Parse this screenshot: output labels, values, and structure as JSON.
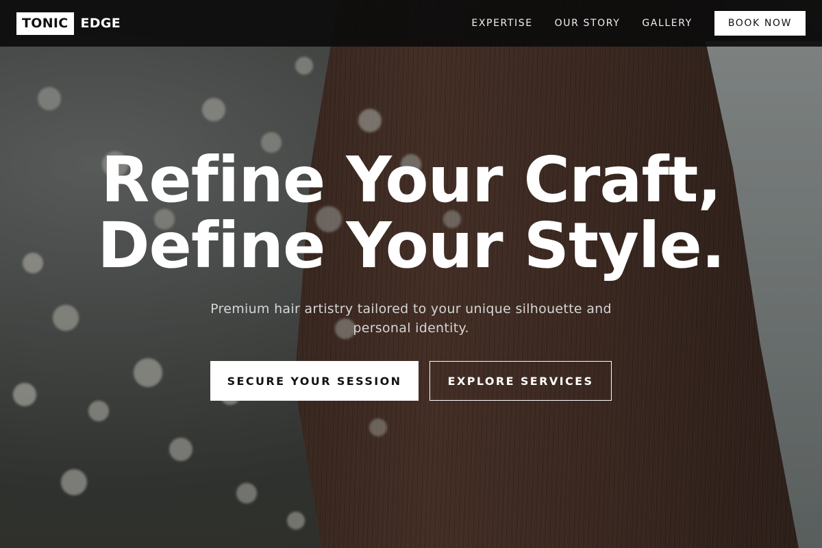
{
  "brand": {
    "logo_box_text": "TONIC",
    "logo_rest_text": "EDGE"
  },
  "nav": {
    "links": [
      "EXPERTISE",
      "OUR STORY",
      "GALLERY"
    ],
    "cta_label": "BOOK NOW"
  },
  "hero": {
    "headline_line1": "Refine Your Craft,",
    "headline_line2": "Define Your Style.",
    "subtext": "Premium hair artistry tailored to your unique silhouette and personal identity.",
    "primary_button": "SECURE YOUR SESSION",
    "secondary_button": "EXPLORE SERVICES"
  },
  "colors": {
    "navbar_bg": "#0c0c0c",
    "accent": "#ffffff",
    "button_text": "#111111"
  }
}
